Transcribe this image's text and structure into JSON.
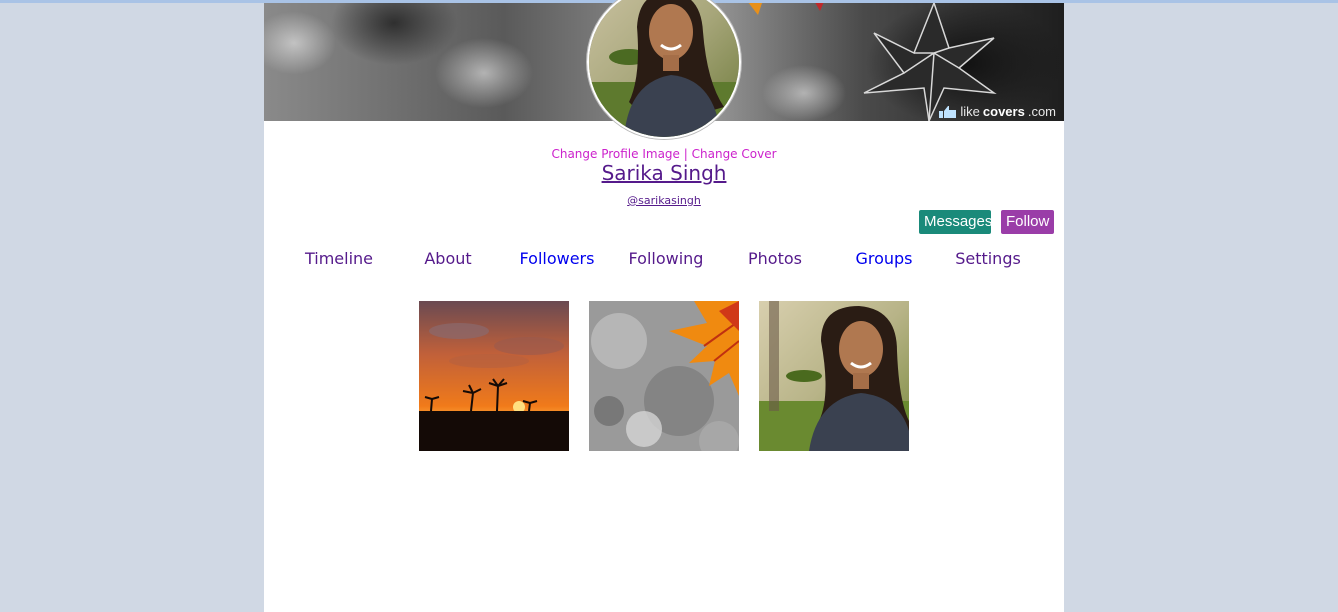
{
  "cover": {
    "brand_prefix": "like",
    "brand_name": "covers",
    "brand_suffix": ".com",
    "brand_icon": "thumbs-up-icon"
  },
  "profile": {
    "change_profile_image": "Change Profile Image",
    "separator": "|",
    "change_cover": "Change Cover",
    "name": "Sarika Singh",
    "handle": "@sarikasingh"
  },
  "actions": {
    "messages_label": "Messages",
    "follow_label": "Follow"
  },
  "tabs": [
    {
      "label": "Timeline"
    },
    {
      "label": "About"
    },
    {
      "label": "Followers"
    },
    {
      "label": "Following"
    },
    {
      "label": "Photos"
    },
    {
      "label": "Groups"
    },
    {
      "label": "Settings"
    }
  ],
  "photos": [
    {
      "subject": "sunset-palm-trees"
    },
    {
      "subject": "autumn-leaf-bokeh"
    },
    {
      "subject": "woman-smiling-portrait"
    }
  ],
  "colors": {
    "background": "#d0d8e4",
    "link_magenta": "#cc22cc",
    "visited_link": "#551a8b",
    "unvisited_link": "#0000ee",
    "messages_button": "#1a8a7a",
    "follow_button": "#9a3da8"
  }
}
